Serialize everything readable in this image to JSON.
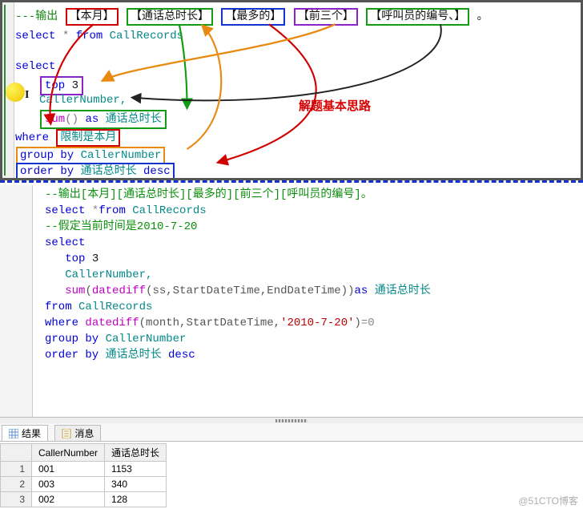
{
  "top": {
    "line1": {
      "prefix": "---输出",
      "tokens": [
        "【本月】",
        "【通话总时长】",
        "【最多的】",
        "【前三个】",
        "【呼叫员的编号、】"
      ],
      "suffix": "。"
    },
    "line2": {
      "select": "select",
      "star": "*",
      "from": "from",
      "table": "CallRecords"
    },
    "line3": {
      "select": "select"
    },
    "line4": {
      "top": "top",
      "n": "3"
    },
    "line5": {
      "col": "CallerNumber,",
      "cursor_char": "I"
    },
    "line6": {
      "sum": "sum",
      "paren": "()",
      "as": "as",
      "alias": "通话总时长"
    },
    "line7": {
      "where": "where",
      "cond": "限制是本月"
    },
    "line8": {
      "group": "group by",
      "col": "CallerNumber"
    },
    "line9": {
      "order": "order by",
      "col": "通话总时长",
      "desc": "desc"
    },
    "title": "解题基本思路"
  },
  "mid": {
    "l1": "--输出[本月][通话总时长][最多的][前三个][呼叫员的编号]。",
    "l2": {
      "select": "select",
      "star": "*",
      "from": "from",
      "table": "CallRecords"
    },
    "l3": "--假定当前时间是2010-7-20",
    "l4": {
      "select": "select"
    },
    "l5": {
      "top": "top",
      "n": "3"
    },
    "l6": {
      "col": "CallerNumber,",
      "punc": ","
    },
    "l7": {
      "sum": "sum",
      "dd": "datediff",
      "args": "(ss,StartDateTime,EndDateTime)",
      "as": "as",
      "alias": "通话总时长"
    },
    "l8": {
      "from": "from",
      "table": "CallRecords"
    },
    "l9": {
      "where": "where",
      "dd": "datediff",
      "args_a": "(month,StartDateTime,",
      "lit": "'2010-7-20'",
      "args_b": ")",
      "eq": "=0"
    },
    "l10": {
      "group": "group by",
      "col": "CallerNumber"
    },
    "l11": {
      "order": "order by",
      "col": "通话总时长",
      "desc": "desc"
    }
  },
  "results": {
    "tab_results": "结果",
    "tab_messages": "消息",
    "columns": [
      "CallerNumber",
      "通话总时长"
    ],
    "rows": [
      {
        "n": "1",
        "CallerNumber": "001",
        "dur": "1153"
      },
      {
        "n": "2",
        "CallerNumber": "003",
        "dur": "340"
      },
      {
        "n": "3",
        "CallerNumber": "002",
        "dur": "128"
      }
    ]
  },
  "watermark": "@51CTO博客"
}
